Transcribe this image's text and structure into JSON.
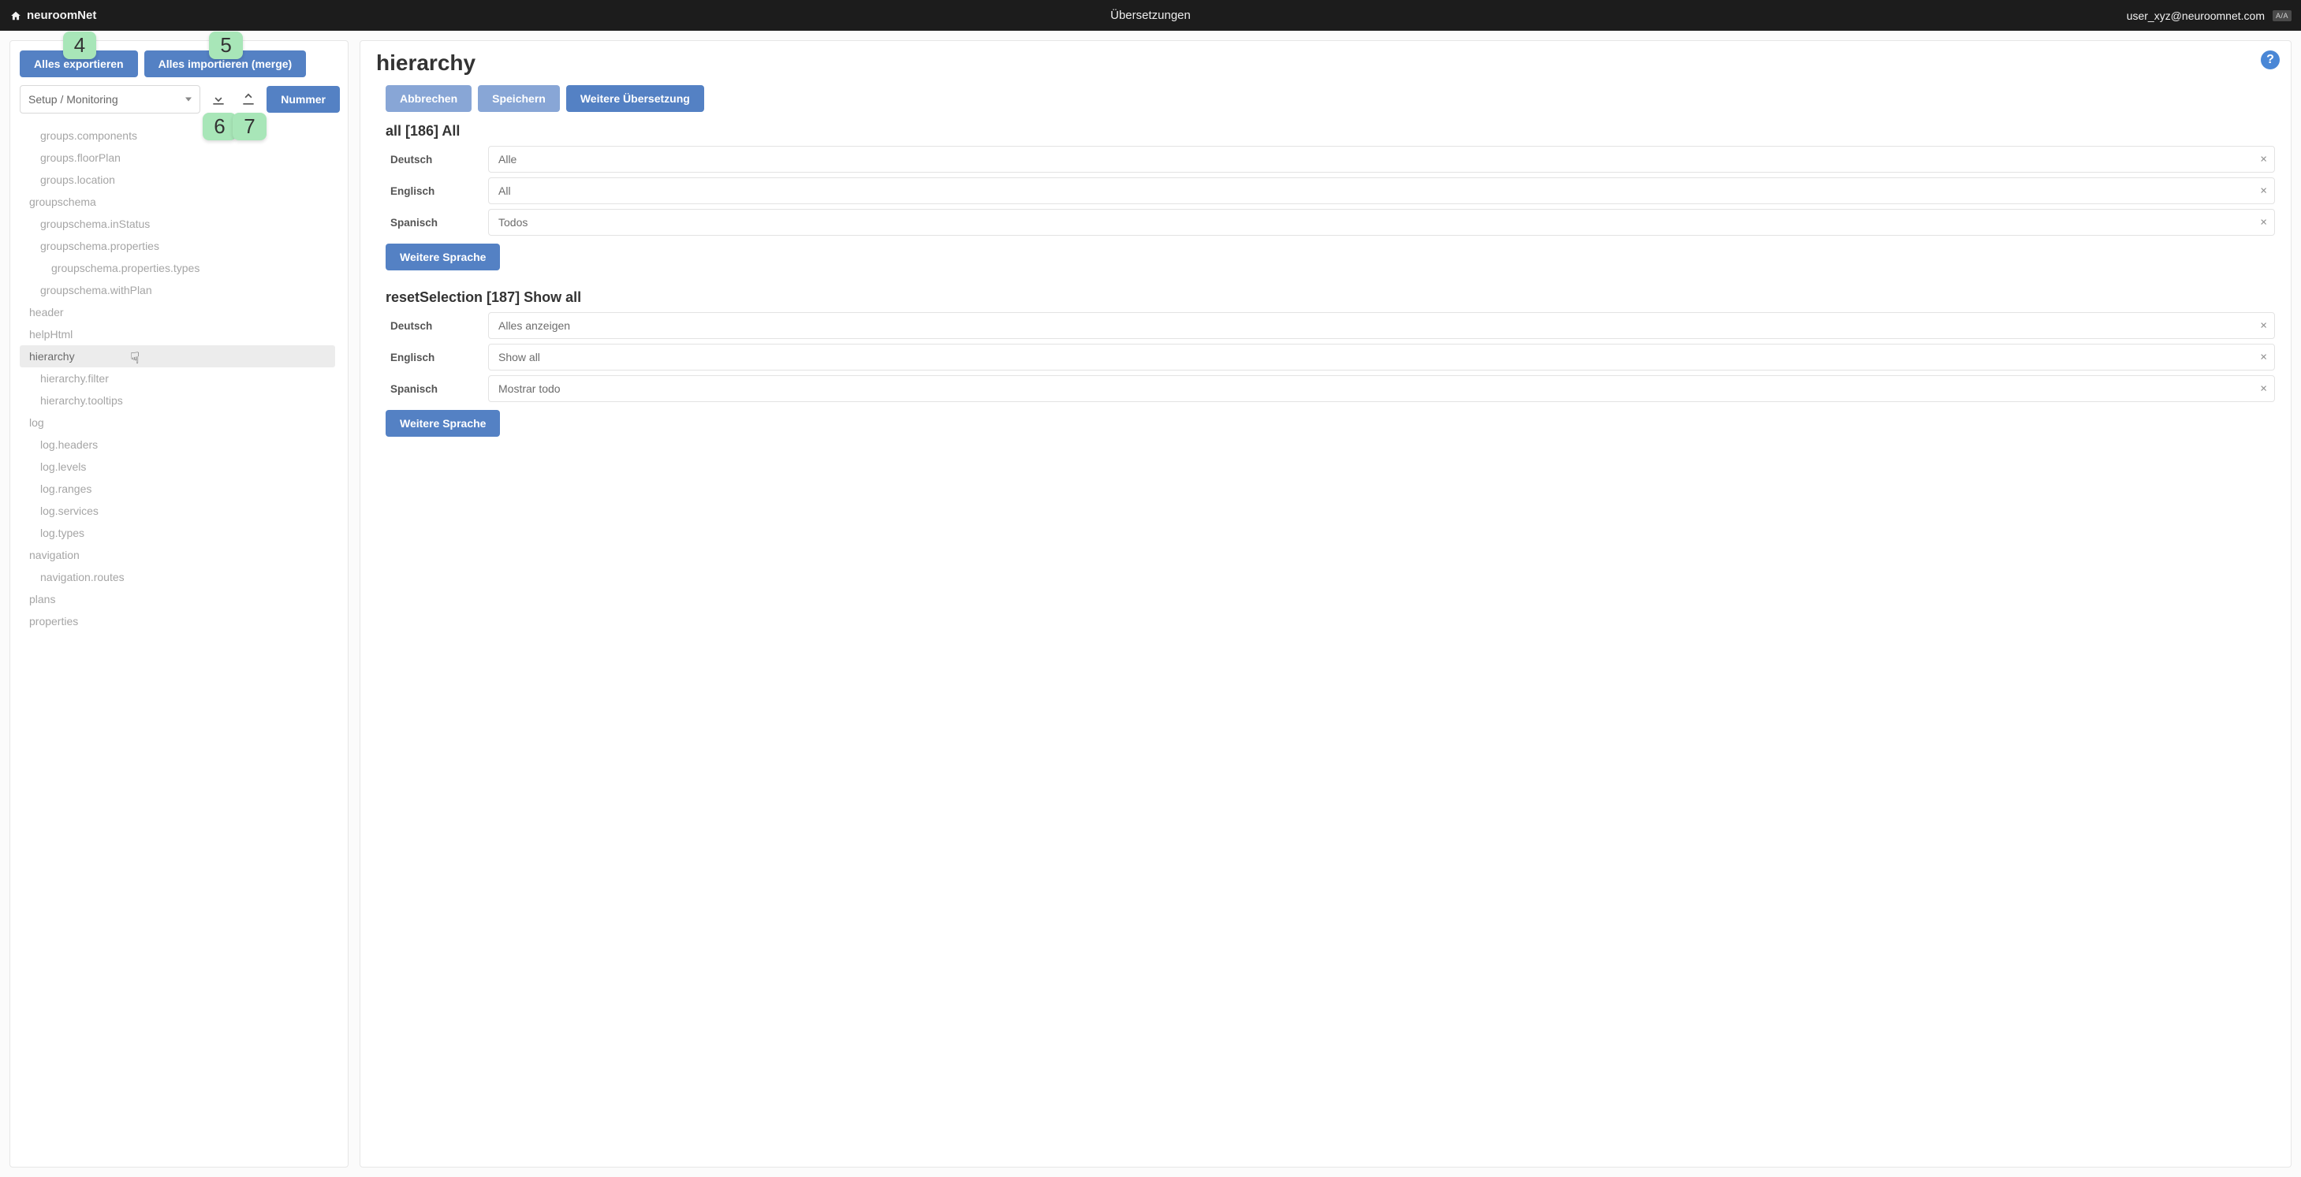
{
  "topbar": {
    "brand": "neuroomNet",
    "title": "Übersetzungen",
    "user": "user_xyz@neuroomnet.com",
    "lang_badge": "A/A"
  },
  "sidebar": {
    "export_all": "Alles exportieren",
    "import_all": "Alles importieren (merge)",
    "nummer": "Nummer",
    "module_select": "Setup / Monitoring",
    "tree": [
      {
        "label": "groups.components",
        "level": 1,
        "selected": false
      },
      {
        "label": "groups.floorPlan",
        "level": 1,
        "selected": false
      },
      {
        "label": "groups.location",
        "level": 1,
        "selected": false
      },
      {
        "label": "groupschema",
        "level": 0,
        "selected": false
      },
      {
        "label": "groupschema.inStatus",
        "level": 1,
        "selected": false
      },
      {
        "label": "groupschema.properties",
        "level": 1,
        "selected": false
      },
      {
        "label": "groupschema.properties.types",
        "level": 2,
        "selected": false
      },
      {
        "label": "groupschema.withPlan",
        "level": 1,
        "selected": false
      },
      {
        "label": "header",
        "level": 0,
        "selected": false
      },
      {
        "label": "helpHtml",
        "level": 0,
        "selected": false
      },
      {
        "label": "hierarchy",
        "level": 0,
        "selected": true
      },
      {
        "label": "hierarchy.filter",
        "level": 1,
        "selected": false
      },
      {
        "label": "hierarchy.tooltips",
        "level": 1,
        "selected": false
      },
      {
        "label": "log",
        "level": 0,
        "selected": false
      },
      {
        "label": "log.headers",
        "level": 1,
        "selected": false
      },
      {
        "label": "log.levels",
        "level": 1,
        "selected": false
      },
      {
        "label": "log.ranges",
        "level": 1,
        "selected": false
      },
      {
        "label": "log.services",
        "level": 1,
        "selected": false
      },
      {
        "label": "log.types",
        "level": 1,
        "selected": false
      },
      {
        "label": "navigation",
        "level": 0,
        "selected": false
      },
      {
        "label": "navigation.routes",
        "level": 1,
        "selected": false
      },
      {
        "label": "plans",
        "level": 0,
        "selected": false
      },
      {
        "label": "properties",
        "level": 0,
        "selected": false
      }
    ]
  },
  "main": {
    "title": "hierarchy",
    "help_tooltip": "?",
    "buttons": {
      "cancel": "Abbrechen",
      "save": "Speichern",
      "more_translation": "Weitere Übersetzung",
      "more_language": "Weitere Sprache"
    },
    "labels": {
      "german": "Deutsch",
      "english": "Englisch",
      "spanish": "Spanisch"
    },
    "sections": [
      {
        "heading": "all [186] All",
        "rows": [
          {
            "lang": "german",
            "value": "Alle"
          },
          {
            "lang": "english",
            "value": "All"
          },
          {
            "lang": "spanish",
            "value": "Todos"
          }
        ]
      },
      {
        "heading": "resetSelection [187] Show all",
        "rows": [
          {
            "lang": "german",
            "value": "Alles anzeigen"
          },
          {
            "lang": "english",
            "value": "Show all"
          },
          {
            "lang": "spanish",
            "value": "Mostrar todo"
          }
        ]
      }
    ]
  },
  "annotations": {
    "n4": "4",
    "n5": "5",
    "n6": "6",
    "n7": "7"
  }
}
